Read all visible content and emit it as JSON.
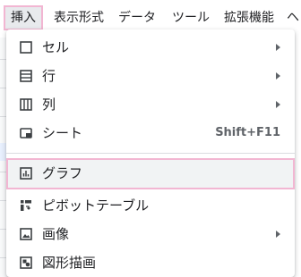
{
  "menubar": {
    "items": [
      {
        "label": "挿入"
      },
      {
        "label": "表示形式"
      },
      {
        "label": "データ"
      },
      {
        "label": "ツール"
      },
      {
        "label": "拡張機能"
      },
      {
        "label": "ヘ"
      }
    ]
  },
  "menu": {
    "items": [
      {
        "label": "セル",
        "icon": "cell-icon"
      },
      {
        "label": "行",
        "icon": "row-icon"
      },
      {
        "label": "列",
        "icon": "column-icon"
      },
      {
        "label": "シート",
        "icon": "sheet-icon",
        "shortcut": "Shift+F11"
      },
      {
        "label": "グラフ",
        "icon": "chart-icon"
      },
      {
        "label": "ピボットテーブル",
        "icon": "pivot-table-icon"
      },
      {
        "label": "画像",
        "icon": "image-icon"
      },
      {
        "label": "図形描画",
        "icon": "drawing-icon"
      }
    ]
  },
  "colors": {
    "highlight_border": "#f2b6d2",
    "icon": "#3c4043"
  }
}
